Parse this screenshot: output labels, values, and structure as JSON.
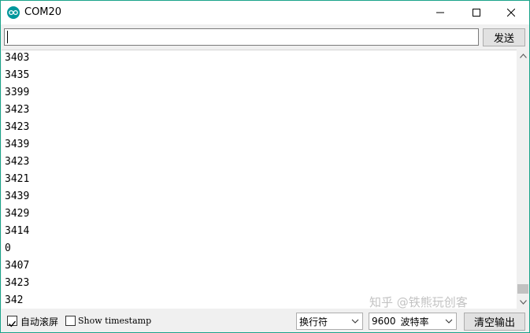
{
  "window": {
    "title": "COM20",
    "accent": "#1aa48a"
  },
  "toolbar": {
    "input_value": "",
    "send_label": "发送"
  },
  "output": {
    "lines": [
      "3403",
      "3435",
      "3399",
      "3423",
      "3423",
      "3439",
      "3423",
      "3421",
      "3439",
      "3429",
      "3414",
      "0",
      "3407",
      "3423",
      "342"
    ]
  },
  "statusbar": {
    "autoscroll_label": "自动滚屏",
    "autoscroll_checked": true,
    "timestamp_label": "Show timestamp",
    "timestamp_checked": false,
    "line_ending": "换行符",
    "baud_value": "9600",
    "baud_unit": "波特率",
    "clear_label": "清空输出"
  },
  "watermark": "知乎 @铁熊玩创客",
  "icons": {
    "app": "arduino-icon",
    "minimize": "minimize-icon",
    "maximize": "maximize-icon",
    "close": "close-icon"
  }
}
